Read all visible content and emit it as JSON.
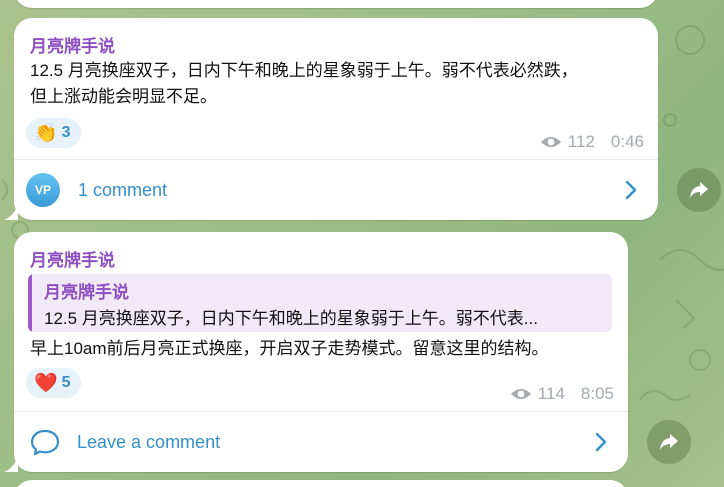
{
  "posts": [
    {
      "sender": "月亮牌手说",
      "text": "12.5 月亮换座双子，日内下午和晚上的星象弱于上午。弱不代表必然跌，\n但上涨动能会明显不足。",
      "reaction": {
        "emoji": "👏",
        "count": "3"
      },
      "views": "112",
      "time": "0:46",
      "comments": {
        "avatar_initials": "VP",
        "label": "1 comment"
      }
    },
    {
      "sender": "月亮牌手说",
      "quote": {
        "sender": "月亮牌手说",
        "text": "12.5 月亮换座双子，日内下午和晚上的星象弱于上午。弱不代表..."
      },
      "text": "早上10am前后月亮正式换座，开启双子走势模式。留意这里的结构。",
      "reaction": {
        "emoji": "❤️",
        "count": "5"
      },
      "views": "114",
      "time": "8:05",
      "comments": {
        "label": "Leave a comment"
      }
    }
  ],
  "icons": {
    "views": "eye-icon",
    "share": "share-icon",
    "chevron": "chevron-right-icon",
    "comment": "comment-bubble-icon"
  },
  "colors": {
    "sender": "#8e4fc0",
    "link": "#3390c9",
    "reaction_bg": "#e6f1fa",
    "quote_bg": "#f1e8f8"
  }
}
